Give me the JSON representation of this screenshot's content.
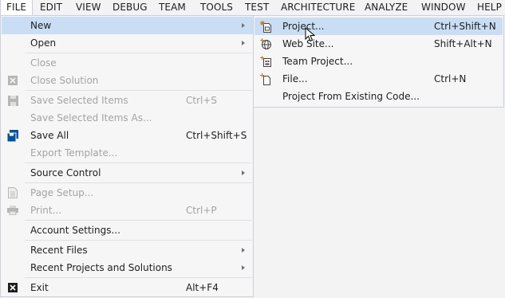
{
  "menubar": {
    "items": [
      "FILE",
      "EDIT",
      "VIEW",
      "DEBUG",
      "TEAM",
      "TOOLS",
      "TEST",
      "ARCHITECTURE",
      "ANALYZE",
      "WINDOW",
      "HELP"
    ]
  },
  "file_menu": {
    "items": [
      {
        "label": "New",
        "shortcut": "",
        "enabled": true,
        "submenu": true,
        "highlighted": true,
        "icon": ""
      },
      {
        "label": "Open",
        "shortcut": "",
        "enabled": true,
        "submenu": true,
        "icon": ""
      },
      {
        "label": "Close",
        "shortcut": "",
        "enabled": false,
        "icon": ""
      },
      {
        "label": "Close Solution",
        "shortcut": "",
        "enabled": false,
        "icon": "close-solution-icon"
      },
      {
        "label": "Save Selected Items",
        "shortcut": "Ctrl+S",
        "enabled": false,
        "icon": "save-icon"
      },
      {
        "label": "Save Selected Items As...",
        "shortcut": "",
        "enabled": false,
        "icon": ""
      },
      {
        "label": "Save All",
        "shortcut": "Ctrl+Shift+S",
        "enabled": true,
        "icon": "save-all-icon"
      },
      {
        "label": "Export Template...",
        "shortcut": "",
        "enabled": false,
        "icon": ""
      },
      {
        "label": "Source Control",
        "shortcut": "",
        "enabled": true,
        "submenu": true,
        "icon": ""
      },
      {
        "label": "Page Setup...",
        "shortcut": "",
        "enabled": false,
        "icon": "page-setup-icon"
      },
      {
        "label": "Print...",
        "shortcut": "Ctrl+P",
        "enabled": false,
        "icon": "printer-icon"
      },
      {
        "label": "Account Settings...",
        "shortcut": "",
        "enabled": true,
        "icon": ""
      },
      {
        "label": "Recent Files",
        "shortcut": "",
        "enabled": true,
        "submenu": true,
        "icon": ""
      },
      {
        "label": "Recent Projects and Solutions",
        "shortcut": "",
        "enabled": true,
        "submenu": true,
        "icon": ""
      },
      {
        "label": "Exit",
        "shortcut": "Alt+F4",
        "enabled": true,
        "icon": "exit-icon"
      }
    ]
  },
  "new_submenu": {
    "items": [
      {
        "label": "Project...",
        "shortcut": "Ctrl+Shift+N",
        "icon": "new-project-icon",
        "highlighted": true
      },
      {
        "label": "Web Site...",
        "shortcut": "Shift+Alt+N",
        "icon": "web-site-icon"
      },
      {
        "label": "Team Project...",
        "shortcut": "",
        "icon": "team-project-icon"
      },
      {
        "label": "File...",
        "shortcut": "Ctrl+N",
        "icon": "new-file-icon"
      },
      {
        "label": "Project From Existing Code...",
        "shortcut": "",
        "icon": ""
      }
    ]
  },
  "colors": {
    "highlight": "#C9DEF5",
    "menu_bg": "#F6F6F6",
    "border": "#CCCEDB",
    "disabled_text": "#A2A4A5",
    "text": "#1E1E1E"
  }
}
